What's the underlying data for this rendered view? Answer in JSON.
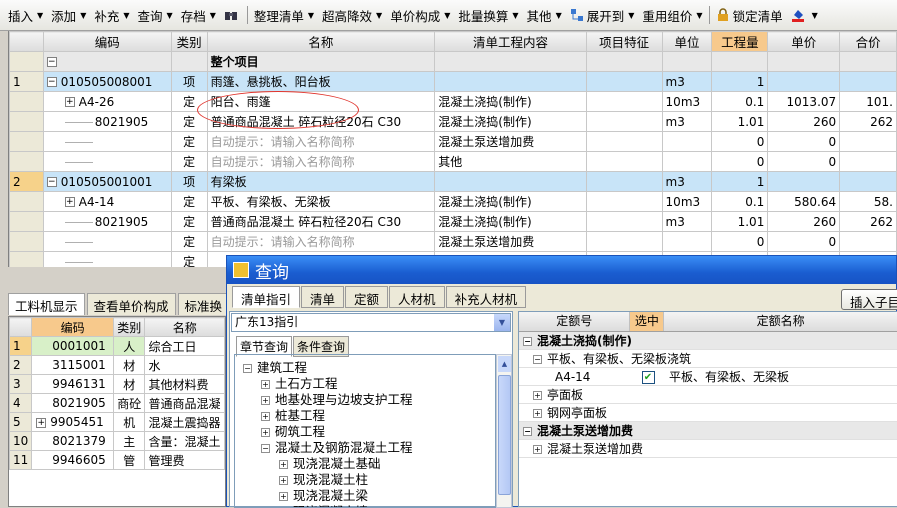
{
  "toolbar": {
    "items": [
      "插入",
      "添加",
      "补充",
      "查询",
      "存档",
      "整理清单",
      "超高降效",
      "单价构成",
      "批量换算",
      "其他",
      "展开到",
      "重用组价",
      "锁定清单"
    ]
  },
  "grid1": {
    "headers": [
      "编码",
      "类别",
      "名称",
      "清单工程内容",
      "项目特征",
      "单位",
      "工程量",
      "单价",
      "合价"
    ],
    "total_row": {
      "exp": "−",
      "name": "整个项目"
    },
    "rows": [
      {
        "num": "1",
        "exp": "−",
        "code": "010505008001",
        "type": "项",
        "name": "雨篷、悬挑板、阳台板",
        "content": "",
        "unit": "m3",
        "qty": "1",
        "price": "",
        "total": ""
      },
      {
        "num": "",
        "exp": "+",
        "code": "A4-26",
        "type": "定",
        "name": "阳台、雨篷",
        "content": "混凝土浇捣(制作)",
        "unit": "10m3",
        "qty": "0.1",
        "price": "1013.07",
        "total": "101."
      },
      {
        "num": "",
        "exp": "",
        "code": "8021905",
        "type": "定",
        "name": "普通商品混凝土 碎石粒径20石 C30",
        "content": "混凝土浇捣(制作)",
        "unit": "m3",
        "qty": "1.01",
        "price": "260",
        "total": "262"
      },
      {
        "num": "",
        "exp": "",
        "code": "",
        "type": "定",
        "name": "自动提示：请输入名称简称",
        "content": "混凝土泵送增加费",
        "unit": "",
        "qty": "0",
        "price": "0",
        "total": ""
      },
      {
        "num": "",
        "exp": "",
        "code": "",
        "type": "定",
        "name": "自动提示：请输入名称简称",
        "content": "其他",
        "unit": "",
        "qty": "0",
        "price": "0",
        "total": ""
      },
      {
        "num": "2",
        "exp": "−",
        "code": "010505001001",
        "type": "项",
        "name": "有梁板",
        "content": "",
        "unit": "m3",
        "qty": "1",
        "price": "",
        "total": ""
      },
      {
        "num": "",
        "exp": "+",
        "code": "A4-14",
        "type": "定",
        "name": "平板、有梁板、无梁板",
        "content": "混凝土浇捣(制作)",
        "unit": "10m3",
        "qty": "0.1",
        "price": "580.64",
        "total": "58."
      },
      {
        "num": "",
        "exp": "",
        "code": "8021905",
        "type": "定",
        "name": "普通商品混凝土 碎石粒径20石 C30",
        "content": "混凝土浇捣(制作)",
        "unit": "m3",
        "qty": "1.01",
        "price": "260",
        "total": "262"
      },
      {
        "num": "",
        "exp": "",
        "code": "",
        "type": "定",
        "name": "自动提示：请输入名称简称",
        "content": "混凝土泵送增加费",
        "unit": "",
        "qty": "0",
        "price": "0",
        "total": ""
      },
      {
        "num": "",
        "exp": "",
        "code": "",
        "type": "定",
        "name": "",
        "content": "",
        "unit": "",
        "qty": "",
        "price": "",
        "total": ""
      }
    ]
  },
  "bottom_tabs": [
    "工料机显示",
    "查看单价构成",
    "标准换"
  ],
  "grid2": {
    "headers": [
      "编码",
      "类别",
      "名称"
    ],
    "rows": [
      {
        "num": "1",
        "exp": "",
        "code": "0001001",
        "type": "人",
        "name": "综合工日"
      },
      {
        "num": "2",
        "exp": "",
        "code": "3115001",
        "type": "材",
        "name": "水"
      },
      {
        "num": "3",
        "exp": "",
        "code": "9946131",
        "type": "材",
        "name": "其他材料费"
      },
      {
        "num": "4",
        "exp": "",
        "code": "8021905",
        "type": "商砼",
        "name": "普通商品混凝"
      },
      {
        "num": "5",
        "exp": "+",
        "code": "9905451",
        "type": "机",
        "name": "混凝土震捣器"
      },
      {
        "num": "10",
        "exp": "",
        "code": "8021379",
        "type": "主",
        "name": "含量：混凝土"
      },
      {
        "num": "11",
        "exp": "",
        "code": "9946605",
        "type": "管",
        "name": "管理费"
      }
    ]
  },
  "dialog": {
    "title": "查询",
    "tabs": [
      "清单指引",
      "清单",
      "定额",
      "人材机",
      "补充人材机"
    ],
    "insert_button": "插入子目",
    "combo_value": "广东13指引",
    "left_tabs": [
      "章节查询",
      "条件查询"
    ],
    "tree": [
      {
        "level": 0,
        "exp": "−",
        "label": "建筑工程"
      },
      {
        "level": 1,
        "exp": "+",
        "label": "土石方工程"
      },
      {
        "level": 1,
        "exp": "+",
        "label": "地基处理与边坡支护工程"
      },
      {
        "level": 1,
        "exp": "+",
        "label": "桩基工程"
      },
      {
        "level": 1,
        "exp": "+",
        "label": "砌筑工程"
      },
      {
        "level": 1,
        "exp": "−",
        "label": "混凝土及钢筋混凝土工程"
      },
      {
        "level": 2,
        "exp": "+",
        "label": "现浇混凝土基础"
      },
      {
        "level": 2,
        "exp": "+",
        "label": "现浇混凝土柱"
      },
      {
        "level": 2,
        "exp": "+",
        "label": "现浇混凝土梁"
      },
      {
        "level": 2,
        "exp": "+",
        "label": "现浇混凝土墙"
      }
    ],
    "right_headers": [
      "定额号",
      "选中",
      "定额名称"
    ],
    "right_rows": [
      {
        "kind": "group",
        "exp": "−",
        "label": "混凝土浇捣(制作)"
      },
      {
        "kind": "sub",
        "exp": "−",
        "label": "平板、有梁板、无梁板浇筑"
      },
      {
        "kind": "item",
        "code": "A4-14",
        "checked": true,
        "label": "平板、有梁板、无梁板"
      },
      {
        "kind": "sub",
        "exp": "+",
        "label": "亭面板"
      },
      {
        "kind": "sub",
        "exp": "+",
        "label": "钢网亭面板"
      },
      {
        "kind": "group",
        "exp": "−",
        "label": "混凝土泵送增加费"
      },
      {
        "kind": "sub",
        "exp": "+",
        "label": "混凝土泵送增加费"
      }
    ]
  }
}
